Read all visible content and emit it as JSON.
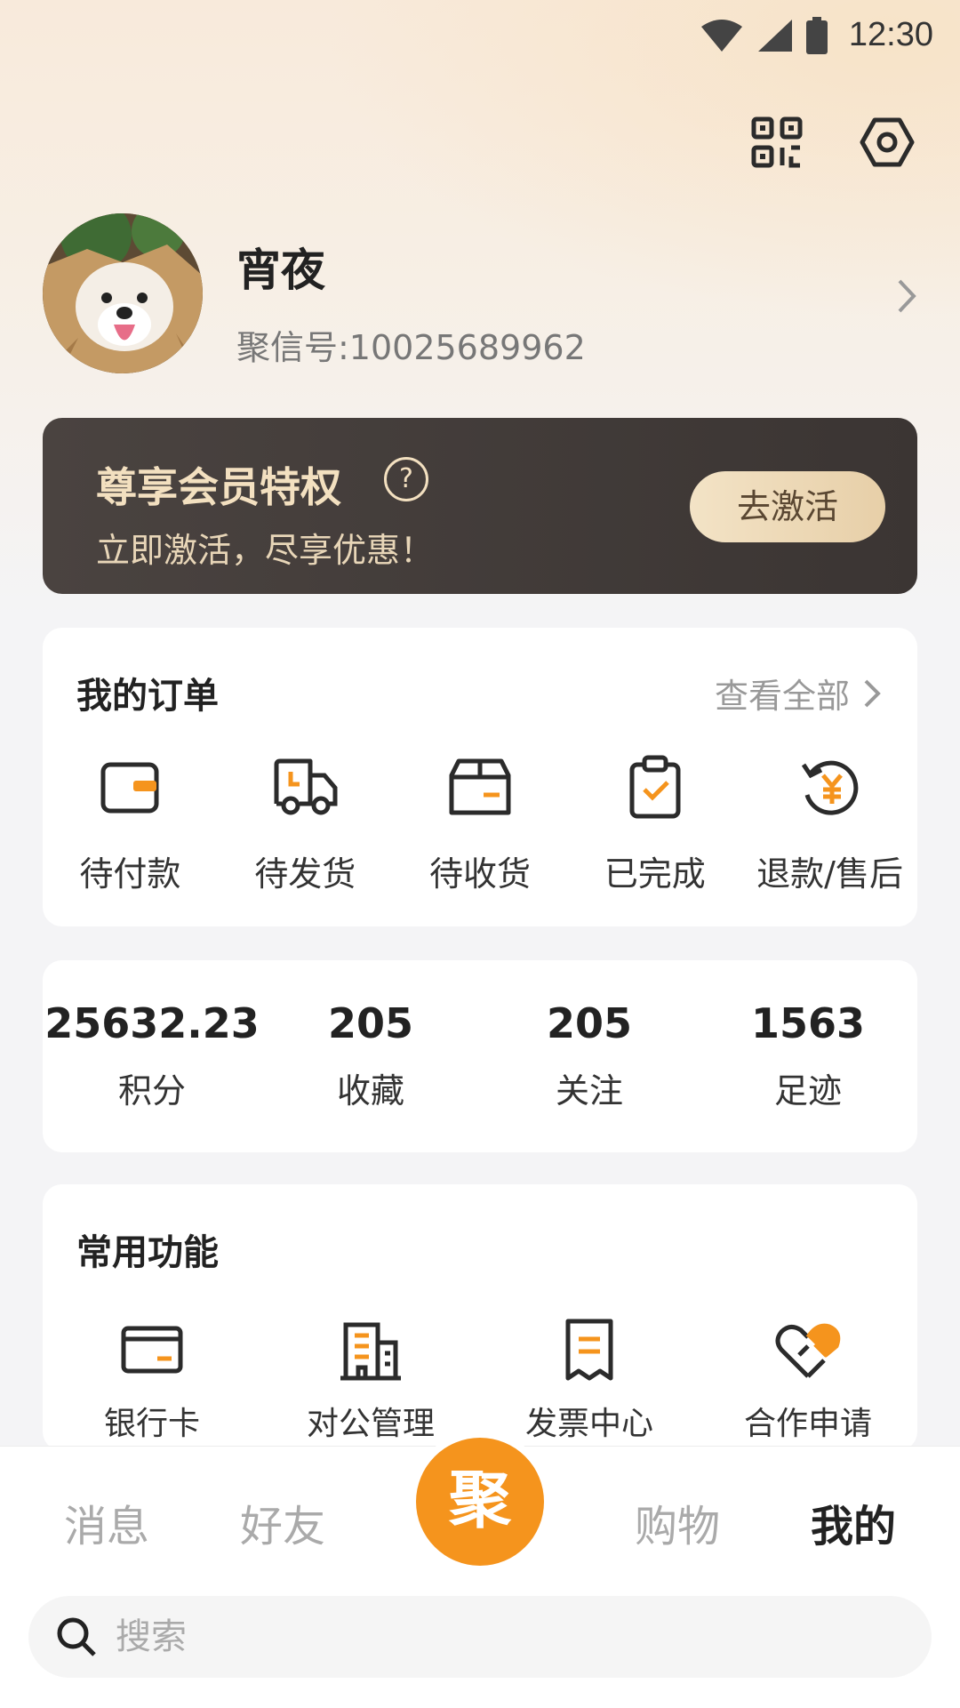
{
  "status_bar": {
    "time": "12:30"
  },
  "header": {
    "qr_icon": "qr-code-icon",
    "settings_icon": "settings-hexagon-icon"
  },
  "profile": {
    "name": "宵夜",
    "id_label": "聚信号:10025689962"
  },
  "vip": {
    "title": "尊享会员特权",
    "help": "?",
    "subtitle": "立即激活，尽享优惠！",
    "button": "去激活"
  },
  "orders": {
    "title": "我的订单",
    "view_all": "查看全部",
    "items": [
      {
        "label": "待付款",
        "icon": "wallet-icon"
      },
      {
        "label": "待发货",
        "icon": "truck-icon"
      },
      {
        "label": "待收货",
        "icon": "box-icon"
      },
      {
        "label": "已完成",
        "icon": "clipboard-check-icon"
      },
      {
        "label": "退款/售后",
        "icon": "refund-yuan-icon"
      }
    ]
  },
  "stats": [
    {
      "value": "25632.23",
      "label": "积分"
    },
    {
      "value": "205",
      "label": "收藏"
    },
    {
      "value": "205",
      "label": "关注"
    },
    {
      "value": "1563",
      "label": "足迹"
    }
  ],
  "functions": {
    "title": "常用功能",
    "items": [
      {
        "label": "银行卡",
        "icon": "bank-card-icon"
      },
      {
        "label": "对公管理",
        "icon": "building-icon"
      },
      {
        "label": "发票中心",
        "icon": "invoice-icon"
      },
      {
        "label": "合作申请",
        "icon": "handshake-heart-icon"
      }
    ]
  },
  "nav": {
    "items": [
      "消息",
      "好友",
      "购物",
      "我的"
    ],
    "center": "聚",
    "active": "我的"
  },
  "search": {
    "placeholder": "搜索"
  },
  "colors": {
    "accent": "#f5941d",
    "icon_dark": "#2b2b2b",
    "vip_bg": "#3f3836"
  }
}
